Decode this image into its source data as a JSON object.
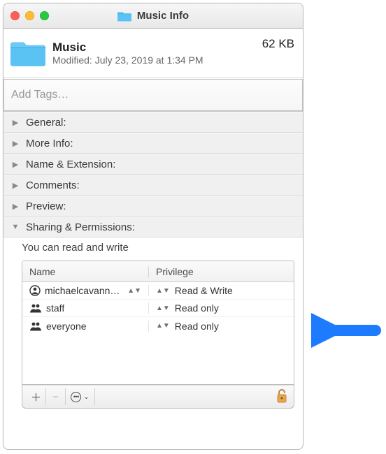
{
  "window": {
    "title": "Music Info"
  },
  "header": {
    "name": "Music",
    "size": "62 KB",
    "modified_label": "Modified:",
    "modified_value": "July 23, 2019 at 1:34 PM"
  },
  "tags": {
    "placeholder": "Add Tags…"
  },
  "sections": [
    {
      "id": "general",
      "label": "General:",
      "open": false
    },
    {
      "id": "moreinfo",
      "label": "More Info:",
      "open": false
    },
    {
      "id": "nameext",
      "label": "Name & Extension:",
      "open": false
    },
    {
      "id": "comments",
      "label": "Comments:",
      "open": false
    },
    {
      "id": "preview",
      "label": "Preview:",
      "open": false
    },
    {
      "id": "sharing",
      "label": "Sharing & Permissions:",
      "open": true
    }
  ],
  "sharing": {
    "summary": "You can read and write",
    "columns": {
      "name": "Name",
      "privilege": "Privilege"
    },
    "rows": [
      {
        "icon": "person",
        "name": "michaelcavann…",
        "privilege": "Read & Write"
      },
      {
        "icon": "group",
        "name": "staff",
        "privilege": "Read only"
      },
      {
        "icon": "group",
        "name": "everyone",
        "privilege": "Read only"
      }
    ]
  },
  "colors": {
    "accent": "#1c7bff",
    "folder": "#5bc2f4"
  }
}
